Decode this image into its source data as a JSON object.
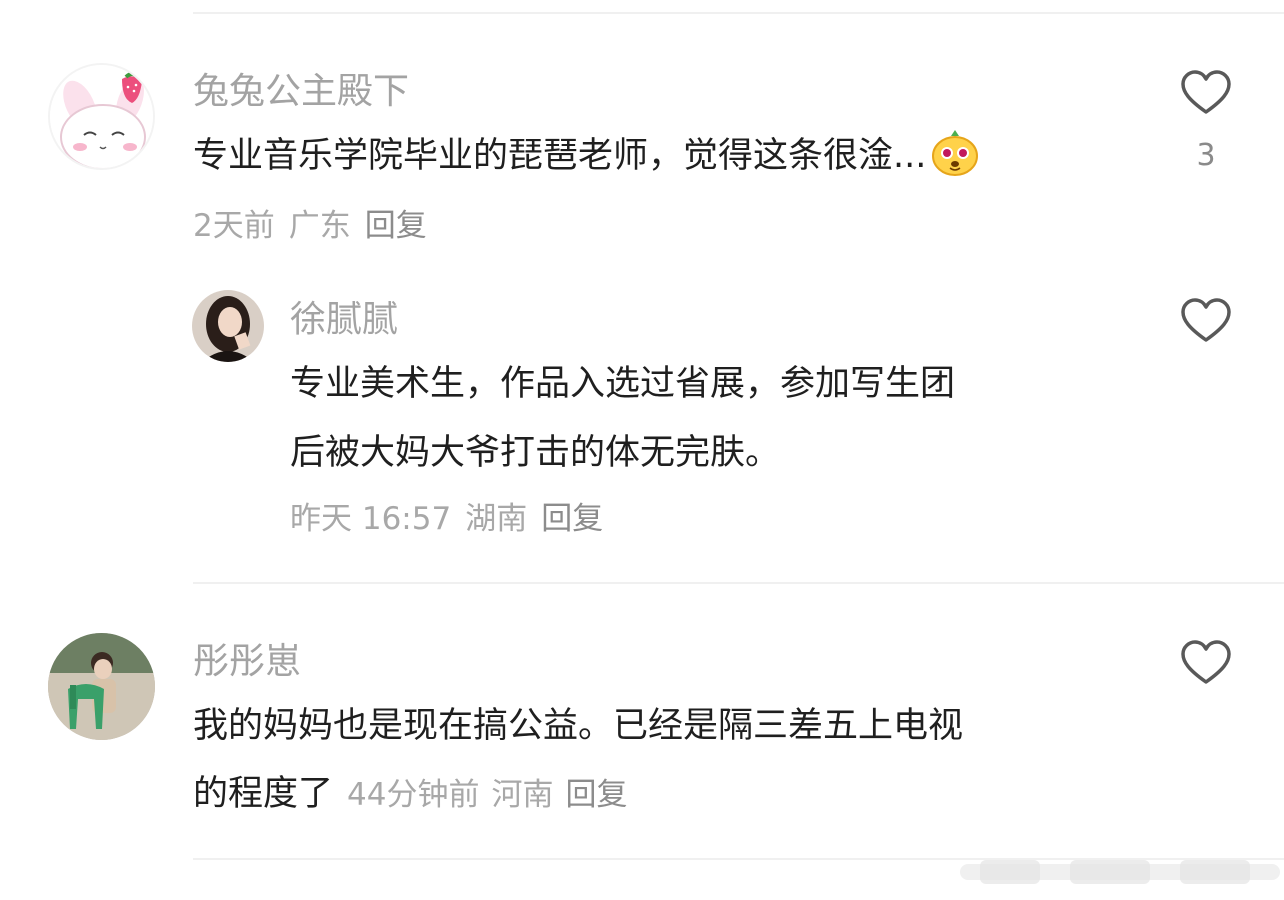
{
  "comments": [
    {
      "username": "兔兔公主殿下",
      "text": "专业音乐学院毕业的琵琶老师，觉得这条很淦...",
      "time": "2天前",
      "location": "广东",
      "reply_label": "回复",
      "like_count": "3",
      "avatar_icon": "cartoon-bunny-strawberry",
      "emoji_icon": "yellow-dog-emoji"
    },
    {
      "username": "徐腻腻",
      "text_lines": [
        "专业美术生，作品入选过省展，参加写生团",
        "后被大妈大爷打击的体无完肤。"
      ],
      "time": "昨天 16:57",
      "location": "湖南",
      "reply_label": "回复",
      "avatar_icon": "woman-portrait"
    },
    {
      "username": "彤彤崽",
      "text_lines": [
        "我的妈妈也是现在搞公益。已经是隔三差五上电视",
        "的程度了"
      ],
      "time": "44分钟前",
      "location": "河南",
      "reply_label": "回复",
      "avatar_icon": "child-with-green-chair"
    }
  ],
  "colors": {
    "username": "#a3a3a3",
    "content": "#1f1f1f",
    "meta": "#a8a8a8",
    "divider": "#f0f0f0",
    "icon": "#595959"
  }
}
